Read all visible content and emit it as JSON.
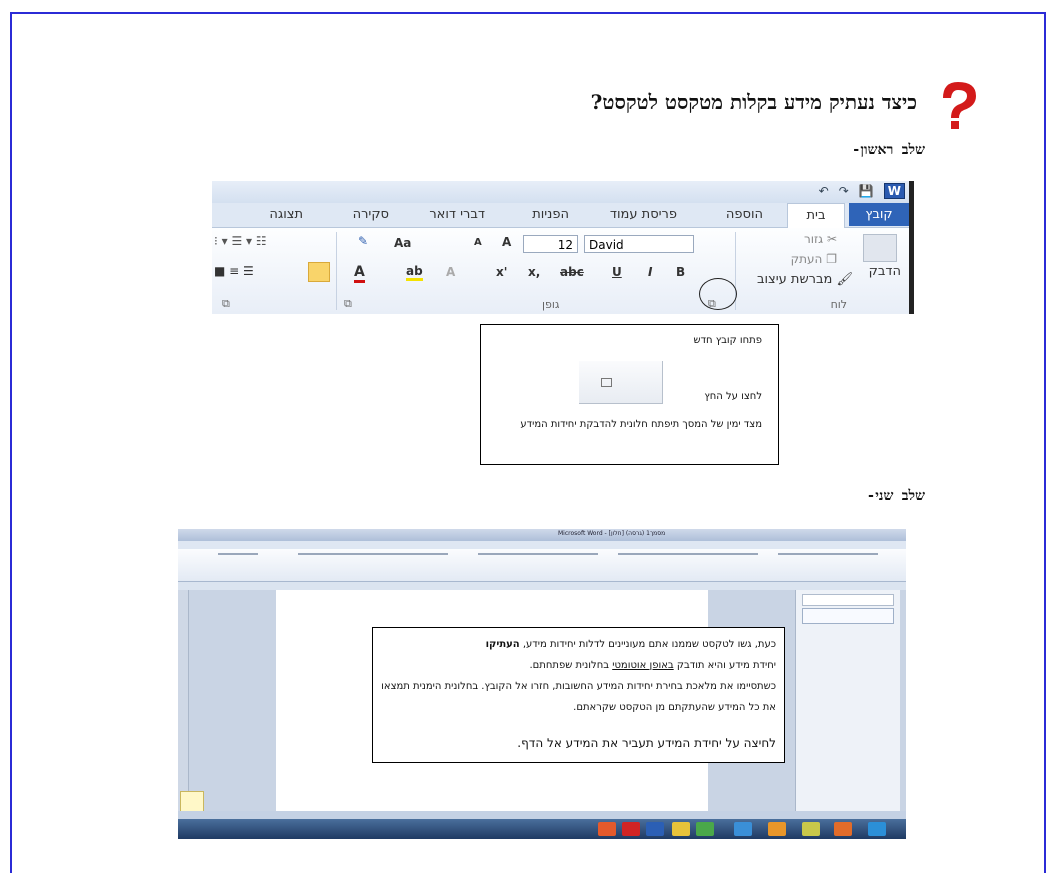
{
  "header": {
    "title": "כיצד נעתיק מידע בקלות מטקסט לטקסט?",
    "step1": "שלב ראשון-",
    "step2": "שלב שני-"
  },
  "ribbon": {
    "tabs": [
      "קובץ",
      "בית",
      "הוספה",
      "פריסת עמוד",
      "הפניות",
      "דברי דואר",
      "סקירה",
      "תצוגה"
    ],
    "clipboard": {
      "paste": "הדבק",
      "cut": "גזור",
      "copy": "העתק",
      "format_painter": "מברשת עיצוב",
      "group": "לוח"
    },
    "font": {
      "name": "David",
      "size": "12",
      "group": "גופן",
      "grow": "A",
      "shrink": "A",
      "case": "Aa",
      "bold": "B",
      "italic": "I",
      "underline": "U",
      "strike": "abc",
      "subscript": "x,",
      "superscript": "x'",
      "color": "A",
      "highlight": "ab",
      "app_icon": "W"
    }
  },
  "box1": {
    "line1": "פתחו קובץ חדש",
    "line2": "לחצו על החץ",
    "line3": "מצד ימין של המסך תיפתח חלונית להדבקת יחידות המידע"
  },
  "word": {
    "window_title": "Microsoft Word - [חלון] (גרסה) מסמך1"
  },
  "box2": {
    "p1_plain": "כעת, גשו לטקסט שממנו אתם מעוניינים לדלות יחידות מידע, ",
    "p1_bold": "העתיקו",
    "p2_a": "יחידת מידע והיא תודבק ",
    "p2_u": "באופן אוטומטי",
    "p2_b": " בחלונית שפתחתם.",
    "p3": "כשתסיימו את מלאכת בחירת יחידות המידע החשובות, חזרו אל הקובץ. בחלונית הימנית תמצאו את כל המידע שהעתקתם מן הטקסט שקראתם.",
    "p4": "לחיצה על יחידת המידע תעביר את המידע אל הדף."
  },
  "colors": {
    "accent": "#2b2bd6",
    "question_mark": "#d31a1a",
    "office_blue": "#2f64b8"
  }
}
